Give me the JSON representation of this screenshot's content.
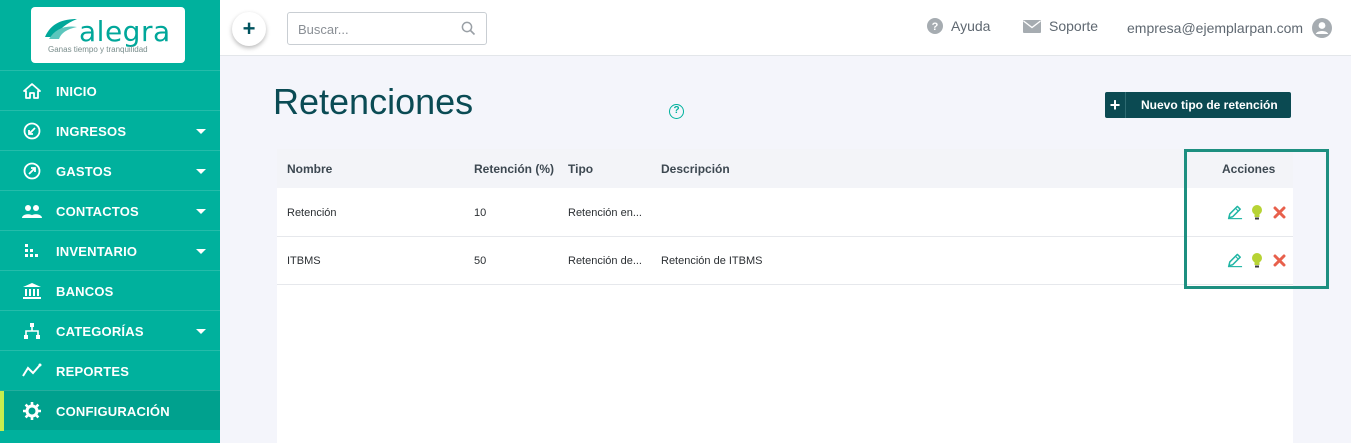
{
  "sidebar": {
    "logo": {
      "word": "alegra",
      "tagline": "Ganas tiempo y tranquilidad"
    },
    "items": [
      {
        "label": "INICIO",
        "icon": "home-icon",
        "has_caret": false
      },
      {
        "label": "INGRESOS",
        "icon": "income-icon",
        "has_caret": true
      },
      {
        "label": "GASTOS",
        "icon": "expenses-icon",
        "has_caret": true
      },
      {
        "label": "CONTACTOS",
        "icon": "contacts-icon",
        "has_caret": true
      },
      {
        "label": "INVENTARIO",
        "icon": "inventory-icon",
        "has_caret": true
      },
      {
        "label": "BANCOS",
        "icon": "bank-icon",
        "has_caret": false
      },
      {
        "label": "CATEGORÍAS",
        "icon": "categories-icon",
        "has_caret": true
      },
      {
        "label": "REPORTES",
        "icon": "reports-icon",
        "has_caret": false
      },
      {
        "label": "CONFIGURACIÓN",
        "icon": "gear-icon",
        "has_caret": false,
        "active": true
      }
    ]
  },
  "topbar": {
    "add_label": "+",
    "search": {
      "placeholder": "Buscar..."
    },
    "help_label": "Ayuda",
    "support_label": "Soporte",
    "account_email": "empresa@ejemplarpan.com"
  },
  "page": {
    "title": "Retenciones",
    "help_glyph": "?",
    "new_button_label": "Nuevo tipo de retención"
  },
  "table": {
    "columns": [
      "Nombre",
      "Retención (%)",
      "Tipo",
      "Descripción",
      "Acciones"
    ],
    "rows": [
      {
        "nombre": "Retención",
        "retencion": "10",
        "tipo": "Retención en...",
        "descripcion": ""
      },
      {
        "nombre": "ITBMS",
        "retencion": "50",
        "tipo": "Retención de...",
        "descripcion": "Retención de ITBMS"
      }
    ]
  },
  "colors": {
    "sidebar": "#00b19d",
    "sidebar_active": "#00a18e",
    "active_marker": "#c7ed4e",
    "primary_dark": "#0b4a52",
    "edit": "#1fb5a4",
    "bulb": "#b7d334",
    "delete": "#e8604c",
    "highlight": "#1d8f80"
  }
}
